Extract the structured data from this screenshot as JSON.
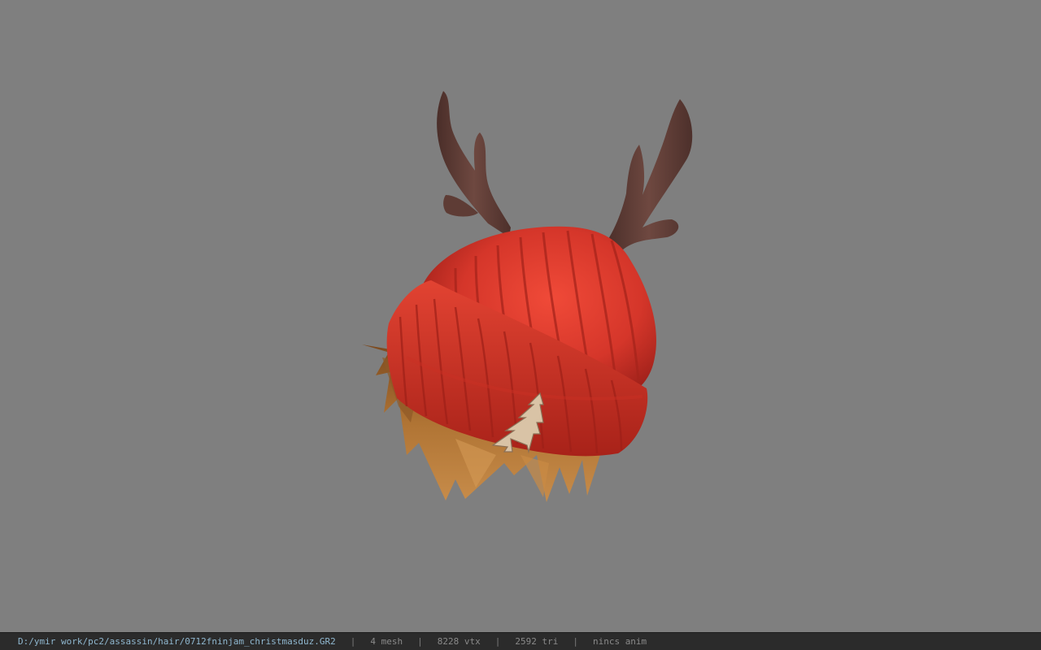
{
  "viewport": {
    "background_color": "#7f7f7f",
    "model": {
      "hat_color": "#d5362a",
      "antler_color": "#5a3a34",
      "hair_color": "#a8692e",
      "badge": "tree-badge-icon"
    }
  },
  "status_bar": {
    "file_path": "D:/ymir work/pc2/assassin/hair/0712fninjam_christmasduz.GR2",
    "separator": "|",
    "mesh": "4 mesh",
    "vertices": "8228 vtx",
    "triangles": "2592 tri",
    "animation": "nincs anim",
    "path_color": "#8fb7cf"
  }
}
